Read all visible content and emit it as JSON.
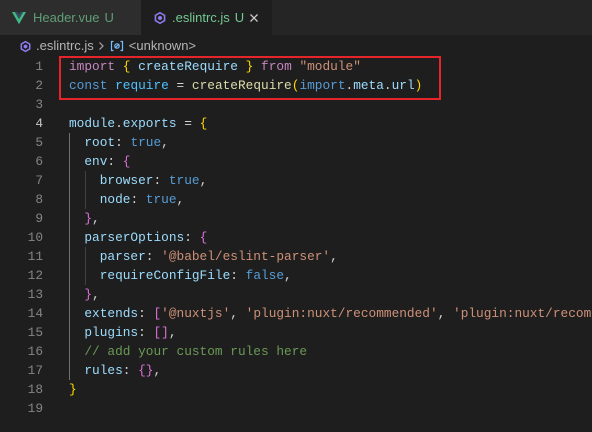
{
  "tabs": [
    {
      "label": "Header.vue",
      "decoration": "U",
      "icon": "vue-icon",
      "active": false
    },
    {
      "label": ".eslintrc.js",
      "decoration": "U",
      "icon": "eslint-icon",
      "active": true,
      "close_icon": "close-icon"
    }
  ],
  "breadcrumb": {
    "file_icon": "eslint-icon",
    "file": ".eslintrc.js",
    "separator_icon": "chevron-right-icon",
    "symbol_icon": "symbol-variable-icon",
    "symbol": "<unknown>"
  },
  "theme": {
    "untracked": "#73c991",
    "highlight_box": "#e5252a",
    "line_number": "#858585",
    "line_number_active": "#c6c6c6"
  },
  "editor": {
    "cursor_line": 4,
    "syntax_colors": {
      "plain": "#d4d4d4",
      "keyword": "#c586c0",
      "storage": "#569cd6",
      "variable": "#9cdcfe",
      "constant": "#4fc1ff",
      "function": "#dcdcaa",
      "string": "#ce9178",
      "comment": "#6a9955",
      "bracket1": "#ffd700",
      "bracket2": "#da70d6"
    },
    "lines": [
      {
        "number": 1,
        "tokens": [
          {
            "text": "import",
            "kind": "keyword"
          },
          {
            "text": " ",
            "kind": "plain"
          },
          {
            "text": "{",
            "kind": "bracket1"
          },
          {
            "text": " ",
            "kind": "plain"
          },
          {
            "text": "createRequire",
            "kind": "variable"
          },
          {
            "text": " ",
            "kind": "plain"
          },
          {
            "text": "}",
            "kind": "bracket1"
          },
          {
            "text": " ",
            "kind": "plain"
          },
          {
            "text": "from",
            "kind": "keyword"
          },
          {
            "text": " ",
            "kind": "plain"
          },
          {
            "text": "\"module\"",
            "kind": "string"
          }
        ]
      },
      {
        "number": 2,
        "tokens": [
          {
            "text": "const",
            "kind": "storage"
          },
          {
            "text": " ",
            "kind": "plain"
          },
          {
            "text": "require",
            "kind": "constant"
          },
          {
            "text": " = ",
            "kind": "plain"
          },
          {
            "text": "createRequire",
            "kind": "function"
          },
          {
            "text": "(",
            "kind": "bracket1"
          },
          {
            "text": "import",
            "kind": "storage"
          },
          {
            "text": ".",
            "kind": "plain"
          },
          {
            "text": "meta",
            "kind": "variable"
          },
          {
            "text": ".",
            "kind": "plain"
          },
          {
            "text": "url",
            "kind": "variable"
          },
          {
            "text": ")",
            "kind": "bracket1"
          }
        ]
      },
      {
        "number": 3,
        "tokens": []
      },
      {
        "number": 4,
        "tokens": [
          {
            "text": "module",
            "kind": "variable"
          },
          {
            "text": ".",
            "kind": "plain"
          },
          {
            "text": "exports",
            "kind": "variable"
          },
          {
            "text": " = ",
            "kind": "plain"
          },
          {
            "text": "{",
            "kind": "bracket1"
          }
        ]
      },
      {
        "number": 5,
        "tokens": [
          {
            "text": "  ",
            "kind": "plain"
          },
          {
            "text": "root",
            "kind": "variable"
          },
          {
            "text": ": ",
            "kind": "plain"
          },
          {
            "text": "true",
            "kind": "storage"
          },
          {
            "text": ",",
            "kind": "plain"
          }
        ]
      },
      {
        "number": 6,
        "tokens": [
          {
            "text": "  ",
            "kind": "plain"
          },
          {
            "text": "env",
            "kind": "variable"
          },
          {
            "text": ": ",
            "kind": "plain"
          },
          {
            "text": "{",
            "kind": "bracket2"
          }
        ]
      },
      {
        "number": 7,
        "tokens": [
          {
            "text": "    ",
            "kind": "plain"
          },
          {
            "text": "browser",
            "kind": "variable"
          },
          {
            "text": ": ",
            "kind": "plain"
          },
          {
            "text": "true",
            "kind": "storage"
          },
          {
            "text": ",",
            "kind": "plain"
          }
        ]
      },
      {
        "number": 8,
        "tokens": [
          {
            "text": "    ",
            "kind": "plain"
          },
          {
            "text": "node",
            "kind": "variable"
          },
          {
            "text": ": ",
            "kind": "plain"
          },
          {
            "text": "true",
            "kind": "storage"
          },
          {
            "text": ",",
            "kind": "plain"
          }
        ]
      },
      {
        "number": 9,
        "tokens": [
          {
            "text": "  ",
            "kind": "plain"
          },
          {
            "text": "}",
            "kind": "bracket2"
          },
          {
            "text": ",",
            "kind": "plain"
          }
        ]
      },
      {
        "number": 10,
        "tokens": [
          {
            "text": "  ",
            "kind": "plain"
          },
          {
            "text": "parserOptions",
            "kind": "variable"
          },
          {
            "text": ": ",
            "kind": "plain"
          },
          {
            "text": "{",
            "kind": "bracket2"
          }
        ]
      },
      {
        "number": 11,
        "tokens": [
          {
            "text": "    ",
            "kind": "plain"
          },
          {
            "text": "parser",
            "kind": "variable"
          },
          {
            "text": ": ",
            "kind": "plain"
          },
          {
            "text": "'@babel/eslint-parser'",
            "kind": "string"
          },
          {
            "text": ",",
            "kind": "plain"
          }
        ]
      },
      {
        "number": 12,
        "tokens": [
          {
            "text": "    ",
            "kind": "plain"
          },
          {
            "text": "requireConfigFile",
            "kind": "variable"
          },
          {
            "text": ": ",
            "kind": "plain"
          },
          {
            "text": "false",
            "kind": "storage"
          },
          {
            "text": ",",
            "kind": "plain"
          }
        ]
      },
      {
        "number": 13,
        "tokens": [
          {
            "text": "  ",
            "kind": "plain"
          },
          {
            "text": "}",
            "kind": "bracket2"
          },
          {
            "text": ",",
            "kind": "plain"
          }
        ]
      },
      {
        "number": 14,
        "tokens": [
          {
            "text": "  ",
            "kind": "plain"
          },
          {
            "text": "extends",
            "kind": "variable"
          },
          {
            "text": ": ",
            "kind": "plain"
          },
          {
            "text": "[",
            "kind": "bracket2"
          },
          {
            "text": "'@nuxtjs'",
            "kind": "string"
          },
          {
            "text": ", ",
            "kind": "plain"
          },
          {
            "text": "'plugin:nuxt/recommended'",
            "kind": "string"
          },
          {
            "text": ", ",
            "kind": "plain"
          },
          {
            "text": "'plugin:nuxt/recom",
            "kind": "string"
          }
        ]
      },
      {
        "number": 15,
        "tokens": [
          {
            "text": "  ",
            "kind": "plain"
          },
          {
            "text": "plugins",
            "kind": "variable"
          },
          {
            "text": ": ",
            "kind": "plain"
          },
          {
            "text": "[]",
            "kind": "bracket2"
          },
          {
            "text": ",",
            "kind": "plain"
          }
        ]
      },
      {
        "number": 16,
        "tokens": [
          {
            "text": "  ",
            "kind": "plain"
          },
          {
            "text": "// add your custom rules here",
            "kind": "comment"
          }
        ]
      },
      {
        "number": 17,
        "tokens": [
          {
            "text": "  ",
            "kind": "plain"
          },
          {
            "text": "rules",
            "kind": "variable"
          },
          {
            "text": ": ",
            "kind": "plain"
          },
          {
            "text": "{}",
            "kind": "bracket2"
          },
          {
            "text": ",",
            "kind": "plain"
          }
        ]
      },
      {
        "number": 18,
        "tokens": [
          {
            "text": "}",
            "kind": "bracket1"
          }
        ]
      },
      {
        "number": 19,
        "tokens": []
      }
    ]
  }
}
